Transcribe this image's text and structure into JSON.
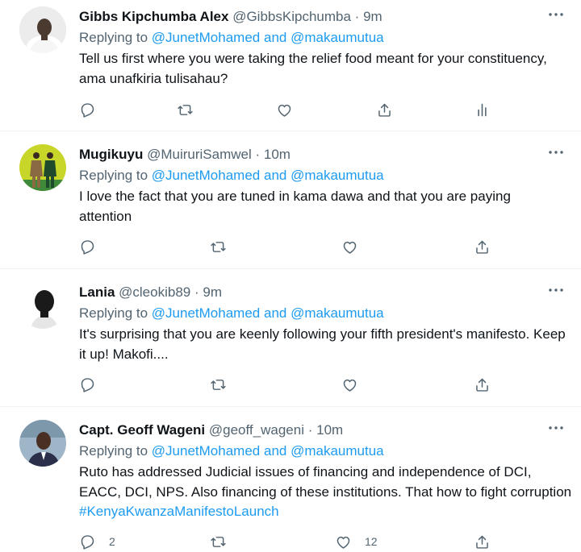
{
  "tweets": [
    {
      "name": "Gibbs Kipchumba Alex",
      "handle": "@GibbsKipchumba",
      "dot": "·",
      "time": "9m",
      "replying_prefix": "Replying to",
      "mention1": "@JunetMohamed",
      "and": "and",
      "mention2": "@makaumutua",
      "text": "Tell us first where you were taking the relief food meant for your constituency, ama unafkiria tulisahau?"
    },
    {
      "name": "Mugikuyu",
      "handle": "@MuiruriSamwel",
      "dot": "·",
      "time": "10m",
      "replying_prefix": "Replying to",
      "mention1": "@JunetMohamed",
      "and": "and",
      "mention2": "@makaumutua",
      "text": "I love the fact that you are tuned in kama dawa and that you are paying attention"
    },
    {
      "name": "Lania",
      "handle": "@cleokib89",
      "dot": "·",
      "time": "9m",
      "replying_prefix": "Replying to",
      "mention1": "@JunetMohamed",
      "and": "and",
      "mention2": "@makaumutua",
      "text": "It's surprising that you are keenly following your fifth president's manifesto. Keep it up! Makofi...."
    },
    {
      "name": "Capt. Geoff Wageni",
      "handle": "@geoff_wageni",
      "dot": "·",
      "time": "10m",
      "replying_prefix": "Replying to",
      "mention1": "@JunetMohamed",
      "and": "and",
      "mention2": "@makaumutua",
      "text": "Ruto has addressed Judicial issues of financing and independence of DCI, EACC, DCI, NPS. Also financing of these institutions. That how to fight corruption ",
      "hashtag": "#KenyaKwanzaManifestoLaunch",
      "reply_count": "2",
      "like_count": "12"
    }
  ],
  "icons": {
    "reply": "reply-icon",
    "retweet": "retweet-icon",
    "like": "like-icon",
    "share": "share-icon",
    "analytics": "analytics-icon",
    "more": "more-icon"
  },
  "colors": {
    "mention": "#1d9bf0",
    "secondary": "#536471",
    "divider": "#eff3f4"
  }
}
